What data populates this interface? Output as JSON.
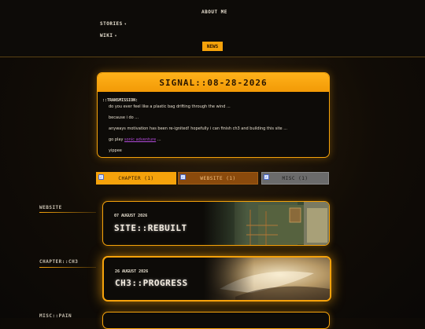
{
  "nav": {
    "about": "ABOUT ME",
    "stories": "STORIES",
    "wiki": "WIKI",
    "news": "NEWS",
    "caret": "▾"
  },
  "signal": {
    "title": "SIGNAL::08-28-2026",
    "transmission_label": "::TRANSMISSION:",
    "lines": {
      "l1": "do you ever feel like a plastic bag drifting through the wind ...",
      "l2": "because i do ...",
      "l3": "anyways motivation has been re-ignited! hopefully i can finish ch3 and building this site ...",
      "l4_prefix": "go play",
      "l4_link": "sonic adventure",
      "l4_suffix": "...",
      "l5": "yippee"
    }
  },
  "filters": [
    {
      "label": "CHAPTER (1)",
      "checked": true
    },
    {
      "label": "WEBSITE (1)",
      "checked": true
    },
    {
      "label": "MISC (1)",
      "checked": true
    }
  ],
  "sections": {
    "website": "WEBSITE",
    "chapter": "CHAPTER::CH3",
    "misc": "MISC::PAIN"
  },
  "posts": {
    "website": {
      "date": "07 AUGUST 2026",
      "title": "SITE::REBUILT"
    },
    "chapter": {
      "date": "26 AUGUST 2026",
      "title": "CH3::PROGRESS"
    }
  },
  "colors": {
    "accent": "#f5a20b",
    "background": "#0d0b08",
    "link": "#b04ad8"
  }
}
